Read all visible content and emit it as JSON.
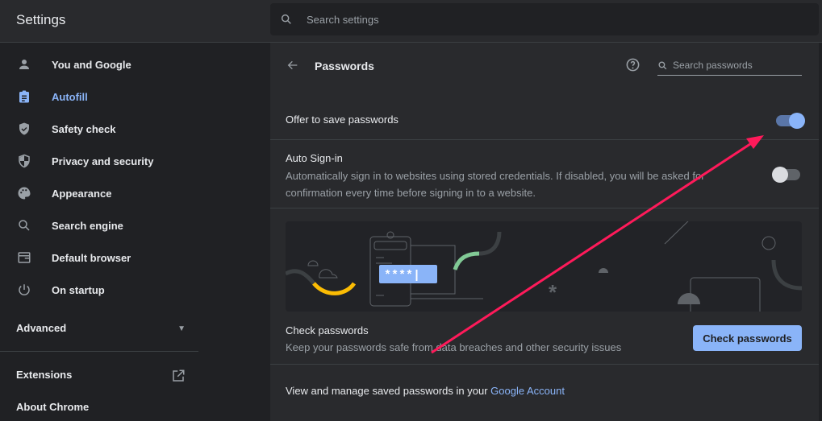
{
  "header": {
    "title": "Settings",
    "search_placeholder": "Search settings"
  },
  "sidebar": {
    "items": [
      {
        "label": "You and Google",
        "icon": "person-icon"
      },
      {
        "label": "Autofill",
        "icon": "clipboard-icon",
        "active": true
      },
      {
        "label": "Safety check",
        "icon": "shield-check-icon"
      },
      {
        "label": "Privacy and security",
        "icon": "shield-half-icon"
      },
      {
        "label": "Appearance",
        "icon": "palette-icon"
      },
      {
        "label": "Search engine",
        "icon": "search-icon"
      },
      {
        "label": "Default browser",
        "icon": "browser-icon"
      },
      {
        "label": "On startup",
        "icon": "power-icon"
      }
    ],
    "advanced": "Advanced",
    "extensions": "Extensions",
    "about": "About Chrome"
  },
  "passwords": {
    "title": "Passwords",
    "search_placeholder": "Search passwords",
    "offer_label": "Offer to save passwords",
    "offer_on": true,
    "autosignin_label": "Auto Sign-in",
    "autosignin_desc": "Automatically sign in to websites using stored credentials. If disabled, you will be asked for confirmation every time before signing in to a website.",
    "autosignin_on": false,
    "illustration_text": "****|",
    "check_title": "Check passwords",
    "check_desc": "Keep your passwords safe from data breaches and other security issues",
    "check_button": "Check passwords",
    "manage_text": "View and manage saved passwords in your ",
    "manage_link": "Google Account"
  },
  "colors": {
    "accent": "#8ab4f8",
    "annotation_arrow": "#ff1a5a"
  }
}
